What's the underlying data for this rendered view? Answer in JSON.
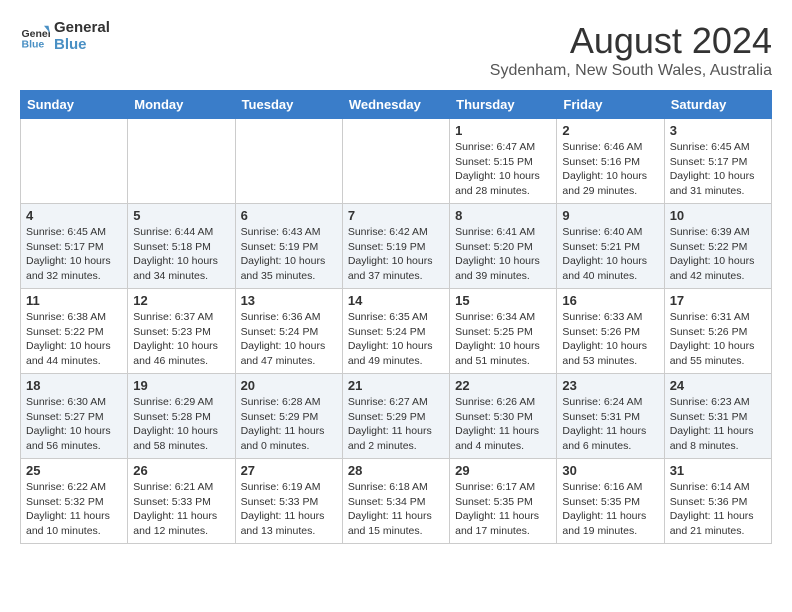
{
  "logo": {
    "line1": "General",
    "line2": "Blue"
  },
  "title": "August 2024",
  "location": "Sydenham, New South Wales, Australia",
  "days_of_week": [
    "Sunday",
    "Monday",
    "Tuesday",
    "Wednesday",
    "Thursday",
    "Friday",
    "Saturday"
  ],
  "weeks": [
    [
      {
        "day": "",
        "info": ""
      },
      {
        "day": "",
        "info": ""
      },
      {
        "day": "",
        "info": ""
      },
      {
        "day": "",
        "info": ""
      },
      {
        "day": "1",
        "info": "Sunrise: 6:47 AM\nSunset: 5:15 PM\nDaylight: 10 hours\nand 28 minutes."
      },
      {
        "day": "2",
        "info": "Sunrise: 6:46 AM\nSunset: 5:16 PM\nDaylight: 10 hours\nand 29 minutes."
      },
      {
        "day": "3",
        "info": "Sunrise: 6:45 AM\nSunset: 5:17 PM\nDaylight: 10 hours\nand 31 minutes."
      }
    ],
    [
      {
        "day": "4",
        "info": "Sunrise: 6:45 AM\nSunset: 5:17 PM\nDaylight: 10 hours\nand 32 minutes."
      },
      {
        "day": "5",
        "info": "Sunrise: 6:44 AM\nSunset: 5:18 PM\nDaylight: 10 hours\nand 34 minutes."
      },
      {
        "day": "6",
        "info": "Sunrise: 6:43 AM\nSunset: 5:19 PM\nDaylight: 10 hours\nand 35 minutes."
      },
      {
        "day": "7",
        "info": "Sunrise: 6:42 AM\nSunset: 5:19 PM\nDaylight: 10 hours\nand 37 minutes."
      },
      {
        "day": "8",
        "info": "Sunrise: 6:41 AM\nSunset: 5:20 PM\nDaylight: 10 hours\nand 39 minutes."
      },
      {
        "day": "9",
        "info": "Sunrise: 6:40 AM\nSunset: 5:21 PM\nDaylight: 10 hours\nand 40 minutes."
      },
      {
        "day": "10",
        "info": "Sunrise: 6:39 AM\nSunset: 5:22 PM\nDaylight: 10 hours\nand 42 minutes."
      }
    ],
    [
      {
        "day": "11",
        "info": "Sunrise: 6:38 AM\nSunset: 5:22 PM\nDaylight: 10 hours\nand 44 minutes."
      },
      {
        "day": "12",
        "info": "Sunrise: 6:37 AM\nSunset: 5:23 PM\nDaylight: 10 hours\nand 46 minutes."
      },
      {
        "day": "13",
        "info": "Sunrise: 6:36 AM\nSunset: 5:24 PM\nDaylight: 10 hours\nand 47 minutes."
      },
      {
        "day": "14",
        "info": "Sunrise: 6:35 AM\nSunset: 5:24 PM\nDaylight: 10 hours\nand 49 minutes."
      },
      {
        "day": "15",
        "info": "Sunrise: 6:34 AM\nSunset: 5:25 PM\nDaylight: 10 hours\nand 51 minutes."
      },
      {
        "day": "16",
        "info": "Sunrise: 6:33 AM\nSunset: 5:26 PM\nDaylight: 10 hours\nand 53 minutes."
      },
      {
        "day": "17",
        "info": "Sunrise: 6:31 AM\nSunset: 5:26 PM\nDaylight: 10 hours\nand 55 minutes."
      }
    ],
    [
      {
        "day": "18",
        "info": "Sunrise: 6:30 AM\nSunset: 5:27 PM\nDaylight: 10 hours\nand 56 minutes."
      },
      {
        "day": "19",
        "info": "Sunrise: 6:29 AM\nSunset: 5:28 PM\nDaylight: 10 hours\nand 58 minutes."
      },
      {
        "day": "20",
        "info": "Sunrise: 6:28 AM\nSunset: 5:29 PM\nDaylight: 11 hours\nand 0 minutes."
      },
      {
        "day": "21",
        "info": "Sunrise: 6:27 AM\nSunset: 5:29 PM\nDaylight: 11 hours\nand 2 minutes."
      },
      {
        "day": "22",
        "info": "Sunrise: 6:26 AM\nSunset: 5:30 PM\nDaylight: 11 hours\nand 4 minutes."
      },
      {
        "day": "23",
        "info": "Sunrise: 6:24 AM\nSunset: 5:31 PM\nDaylight: 11 hours\nand 6 minutes."
      },
      {
        "day": "24",
        "info": "Sunrise: 6:23 AM\nSunset: 5:31 PM\nDaylight: 11 hours\nand 8 minutes."
      }
    ],
    [
      {
        "day": "25",
        "info": "Sunrise: 6:22 AM\nSunset: 5:32 PM\nDaylight: 11 hours\nand 10 minutes."
      },
      {
        "day": "26",
        "info": "Sunrise: 6:21 AM\nSunset: 5:33 PM\nDaylight: 11 hours\nand 12 minutes."
      },
      {
        "day": "27",
        "info": "Sunrise: 6:19 AM\nSunset: 5:33 PM\nDaylight: 11 hours\nand 13 minutes."
      },
      {
        "day": "28",
        "info": "Sunrise: 6:18 AM\nSunset: 5:34 PM\nDaylight: 11 hours\nand 15 minutes."
      },
      {
        "day": "29",
        "info": "Sunrise: 6:17 AM\nSunset: 5:35 PM\nDaylight: 11 hours\nand 17 minutes."
      },
      {
        "day": "30",
        "info": "Sunrise: 6:16 AM\nSunset: 5:35 PM\nDaylight: 11 hours\nand 19 minutes."
      },
      {
        "day": "31",
        "info": "Sunrise: 6:14 AM\nSunset: 5:36 PM\nDaylight: 11 hours\nand 21 minutes."
      }
    ]
  ]
}
